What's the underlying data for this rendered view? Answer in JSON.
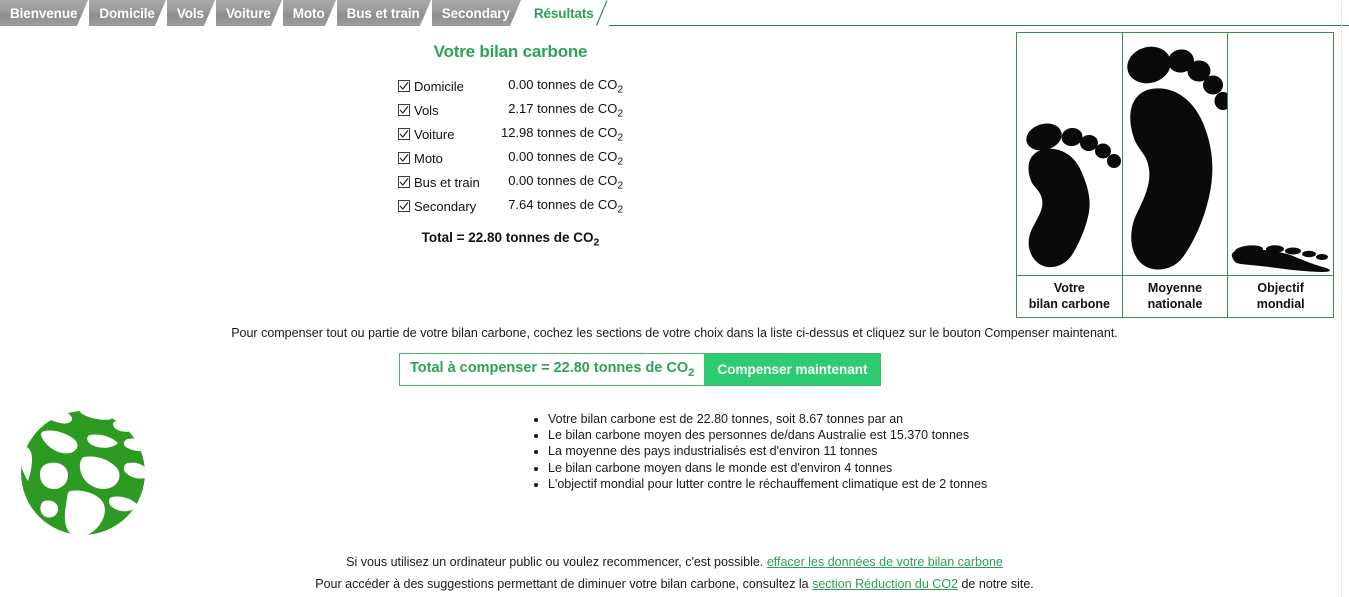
{
  "tabs": [
    {
      "label": "Bienvenue",
      "active": false
    },
    {
      "label": "Domicile",
      "active": false
    },
    {
      "label": "Vols",
      "active": false
    },
    {
      "label": "Voiture",
      "active": false
    },
    {
      "label": "Moto",
      "active": false
    },
    {
      "label": "Bus et train",
      "active": false
    },
    {
      "label": "Secondary",
      "active": false
    },
    {
      "label": "Résultats",
      "active": true
    }
  ],
  "summary": {
    "heading": "Votre bilan carbone",
    "unit": "tonnes de CO",
    "unit_sub": "2",
    "rows": [
      {
        "label": "Domicile",
        "value": "0.00",
        "checked": true
      },
      {
        "label": "Vols",
        "value": "2.17",
        "checked": true
      },
      {
        "label": "Voiture",
        "value": "12.98",
        "checked": true
      },
      {
        "label": "Moto",
        "value": "0.00",
        "checked": true
      },
      {
        "label": "Bus et train",
        "value": "0.00",
        "checked": true
      },
      {
        "label": "Secondary",
        "value": "7.64",
        "checked": true
      }
    ],
    "total_prefix": "Total = 22.80 tonnes de CO",
    "total_sub": "2"
  },
  "footprints": {
    "columns": [
      {
        "caption_line1": "Votre",
        "caption_line2": "bilan carbone",
        "icon": "footprint-icon",
        "size": "small"
      },
      {
        "caption_line1": "Moyenne",
        "caption_line2": "nationale",
        "icon": "footprint-icon",
        "size": "large"
      },
      {
        "caption_line1": "Objectif",
        "caption_line2": "mondial",
        "icon": "footprint-squashed-icon",
        "size": "flat"
      }
    ]
  },
  "instruction": "Pour compenser tout ou partie de votre bilan carbone, cochez les sections de votre choix dans la liste ci-dessus et cliquez sur le bouton Compenser maintenant.",
  "compensate": {
    "total_prefix": "Total à compenser = 22.80 tonnes de CO",
    "total_sub": "2",
    "button_label": "Compenser maintenant"
  },
  "facts": [
    "Votre bilan carbone est de 22.80 tonnes, soit 8.67 tonnes par an",
    "Le bilan carbone moyen des personnes de/dans Australie est 15.370 tonnes",
    "La moyenne des pays industrialisés est d'environ 11 tonnes",
    "Le bilan carbone moyen dans le monde est d'environ 4 tonnes",
    "L'objectif mondial pour lutter contre le réchauffement climatique est de 2 tonnes"
  ],
  "footer": {
    "line1_before": "Si vous utilisez un ordinateur public ou voulez recommencer, c'est possible.",
    "line1_link": "effacer les données de votre bilan carbone",
    "line2_before": "Pour accéder à des suggestions permettant de diminuer votre bilan carbone, consultez la",
    "line2_link": "section Réduction du CO2",
    "line2_after": "de notre site."
  },
  "colors": {
    "brand_green": "#2fa158",
    "button_green": "#2ecc71",
    "border_green": "#3f8a57",
    "tab_gray": "#9a9a9a",
    "globe_green": "#2d9a21"
  }
}
